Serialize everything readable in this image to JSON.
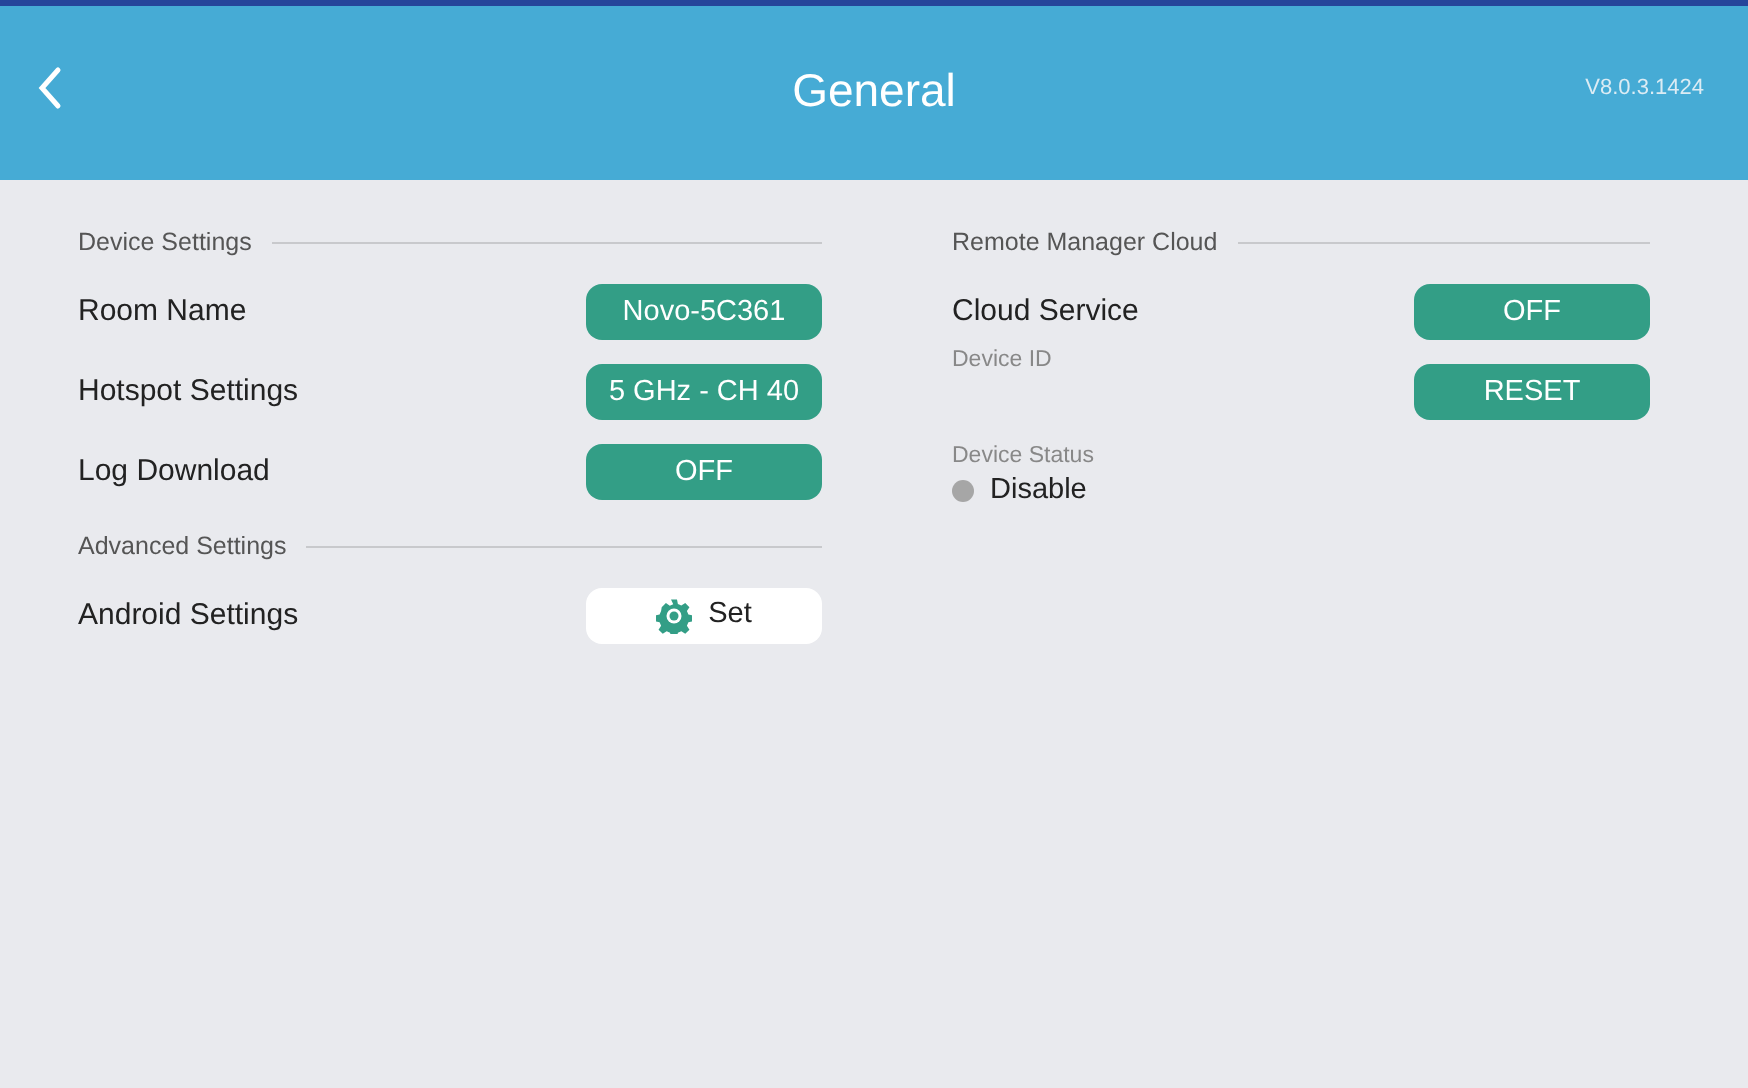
{
  "header": {
    "title": "General",
    "version": "V8.0.3.1424"
  },
  "device_sections": [
    {
      "heading": "Device Settings",
      "rows": [
        {
          "label": "Room Name",
          "kind": "value",
          "button": "Novo-5C361"
        },
        {
          "label": "Hotspot Settings",
          "kind": "value",
          "button": "5 GHz - CH 40"
        },
        {
          "label": "Log Download",
          "kind": "value",
          "button": "OFF"
        }
      ]
    },
    {
      "heading": "Advanced Settings",
      "rows": [
        {
          "label": "Android Settings",
          "kind": "set",
          "button": "Set"
        }
      ]
    }
  ],
  "remote_manager": {
    "heading": "Remote Manager Cloud",
    "cloud_service": {
      "label": "Cloud Service",
      "button": "OFF"
    },
    "device_id": {
      "label": "Device ID",
      "button": "RESET"
    },
    "device_status": {
      "label": "Device Status",
      "value": "Disable"
    }
  }
}
